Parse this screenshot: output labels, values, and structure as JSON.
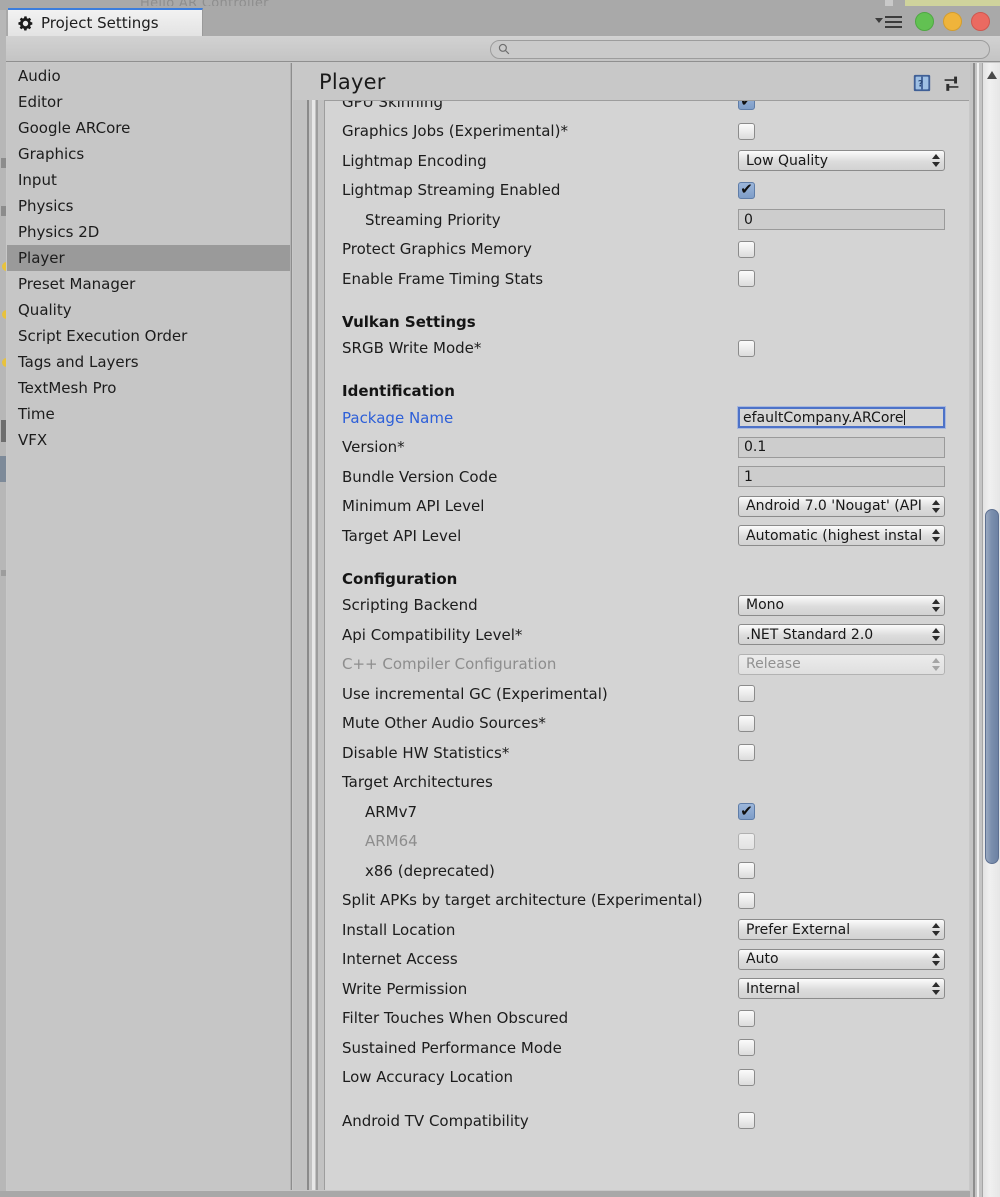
{
  "window": {
    "tab_label": "Project Settings",
    "tab_icon": "gear-icon",
    "accent_color": "#3b7ddd",
    "controls": {
      "menu_icon": "dropdown-menu-icon",
      "green_label": "maximize",
      "yellow_label": "minimize",
      "red_label": "close"
    }
  },
  "search": {
    "icon": "search-icon",
    "value": "",
    "placeholder": ""
  },
  "sidebar": {
    "items": [
      {
        "label": "Audio",
        "selected": false
      },
      {
        "label": "Editor",
        "selected": false
      },
      {
        "label": "Google ARCore",
        "selected": false
      },
      {
        "label": "Graphics",
        "selected": false
      },
      {
        "label": "Input",
        "selected": false
      },
      {
        "label": "Physics",
        "selected": false
      },
      {
        "label": "Physics 2D",
        "selected": false
      },
      {
        "label": "Player",
        "selected": true
      },
      {
        "label": "Preset Manager",
        "selected": false
      },
      {
        "label": "Quality",
        "selected": false
      },
      {
        "label": "Script Execution Order",
        "selected": false
      },
      {
        "label": "Tags and Layers",
        "selected": false
      },
      {
        "label": "TextMesh Pro",
        "selected": false
      },
      {
        "label": "Time",
        "selected": false
      },
      {
        "label": "VFX",
        "selected": false
      }
    ]
  },
  "panel": {
    "title": "Player",
    "icons": [
      {
        "name": "help-book-icon",
        "glyph": "?"
      },
      {
        "name": "preset-icon",
        "glyph": ""
      },
      {
        "name": "gear-settings-icon",
        "glyph": ""
      }
    ]
  },
  "form": {
    "rows": [
      {
        "label": "GPU Skinning",
        "control": "checkbox",
        "value": "on",
        "clipped_top": true
      },
      {
        "label": "Graphics Jobs (Experimental)*",
        "control": "checkbox",
        "value": "off"
      },
      {
        "label": "Lightmap Encoding",
        "control": "dropdown",
        "value": "Low Quality"
      },
      {
        "label": "Lightmap Streaming Enabled",
        "control": "checkbox",
        "value": "on"
      },
      {
        "label": "Streaming Priority",
        "control": "textfield",
        "value": "0",
        "indent": 1
      },
      {
        "label": "Protect Graphics Memory",
        "control": "checkbox",
        "value": "off"
      },
      {
        "label": "Enable Frame Timing Stats",
        "control": "checkbox",
        "value": "off"
      },
      {
        "label": "Vulkan Settings",
        "control": "section"
      },
      {
        "label": "SRGB Write Mode*",
        "control": "checkbox",
        "value": "off"
      },
      {
        "label": "Identification",
        "control": "section"
      },
      {
        "label": "Package Name",
        "control": "textfield",
        "value": "efaultCompany.ARCore",
        "focused": true,
        "label_color": "blue"
      },
      {
        "label": "Version*",
        "control": "textfield",
        "value": "0.1"
      },
      {
        "label": "Bundle Version Code",
        "control": "textfield",
        "value": "1"
      },
      {
        "label": "Minimum API Level",
        "control": "dropdown",
        "value": "Android 7.0 'Nougat' (API"
      },
      {
        "label": "Target API Level",
        "control": "dropdown",
        "value": "Automatic (highest instal"
      },
      {
        "label": "Configuration",
        "control": "section"
      },
      {
        "label": "Scripting Backend",
        "control": "dropdown",
        "value": "Mono"
      },
      {
        "label": "Api Compatibility Level*",
        "control": "dropdown",
        "value": ".NET Standard 2.0"
      },
      {
        "label": "C++ Compiler Configuration",
        "control": "dropdown",
        "value": "Release",
        "disabled": true
      },
      {
        "label": "Use incremental GC (Experimental)",
        "control": "checkbox",
        "value": "off"
      },
      {
        "label": "Mute Other Audio Sources*",
        "control": "checkbox",
        "value": "off"
      },
      {
        "label": "Disable HW Statistics*",
        "control": "checkbox",
        "value": "off"
      },
      {
        "label": "Target Architectures",
        "control": "none"
      },
      {
        "label": "ARMv7",
        "control": "checkbox",
        "value": "on",
        "indent": 1
      },
      {
        "label": "ARM64",
        "control": "checkbox",
        "value": "off",
        "indent": 1,
        "disabled": true
      },
      {
        "label": "x86 (deprecated)",
        "control": "checkbox",
        "value": "off",
        "indent": 1
      },
      {
        "label": "Split APKs by target architecture (Experimental)",
        "control": "checkbox",
        "value": "off",
        "label_clipped": true
      },
      {
        "label": "Install Location",
        "control": "dropdown",
        "value": "Prefer External"
      },
      {
        "label": "Internet Access",
        "control": "dropdown",
        "value": "Auto"
      },
      {
        "label": "Write Permission",
        "control": "dropdown",
        "value": "Internal"
      },
      {
        "label": "Filter Touches When Obscured",
        "control": "checkbox",
        "value": "off"
      },
      {
        "label": "Sustained Performance Mode",
        "control": "checkbox",
        "value": "off"
      },
      {
        "label": "Low Accuracy Location",
        "control": "checkbox",
        "value": "off"
      },
      {
        "label": "Android TV Compatibility",
        "control": "checkbox",
        "value": "off",
        "gap_before": true
      }
    ]
  },
  "scrollbar": {
    "orientation": "vertical",
    "thumb_top_pct": 38,
    "thumb_height_pct": 32,
    "arrow_icon": "triangle-up-icon"
  }
}
